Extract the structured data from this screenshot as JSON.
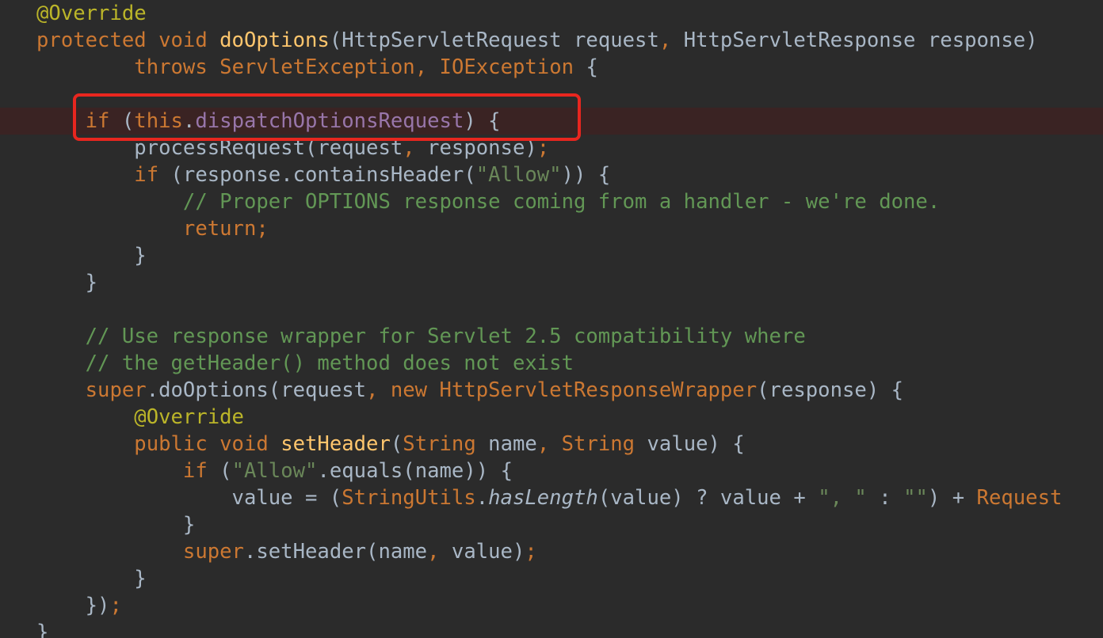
{
  "colors": {
    "background": "#2b2b2b",
    "breakpoint_line": "#3a2323",
    "keyword": "#cc7832",
    "annotation": "#bbb529",
    "method": "#ffc66d",
    "string": "#6a8759",
    "comment": "#629755",
    "field": "#9876aa",
    "plain": "#a9b7c6",
    "highlight_border": "#e8261f"
  },
  "code": {
    "lines": [
      [
        {
          "t": "ann",
          "v": "@Override"
        }
      ],
      [
        {
          "t": "kw",
          "v": "protected void "
        },
        {
          "t": "fn",
          "v": "doOptions"
        },
        {
          "t": "pl",
          "v": "(HttpServletRequest request"
        },
        {
          "t": "kw",
          "v": ", "
        },
        {
          "t": "pl",
          "v": "HttpServletResponse response)"
        }
      ],
      [
        {
          "t": "pl",
          "v": "        "
        },
        {
          "t": "kw",
          "v": "throws "
        },
        {
          "t": "kw",
          "v": "ServletException"
        },
        {
          "t": "kw",
          "v": ", "
        },
        {
          "t": "kw",
          "v": "IOException "
        },
        {
          "t": "pl",
          "v": "{"
        }
      ],
      [],
      [
        {
          "t": "pl",
          "v": "    "
        },
        {
          "t": "kw",
          "v": "if "
        },
        {
          "t": "pl",
          "v": "("
        },
        {
          "t": "kw",
          "v": "this"
        },
        {
          "t": "pl",
          "v": "."
        },
        {
          "t": "fld",
          "v": "dispatchOptionsRequest"
        },
        {
          "t": "pl",
          "v": ") {"
        }
      ],
      [
        {
          "t": "pl",
          "v": "        processRequest(request"
        },
        {
          "t": "kw",
          "v": ", "
        },
        {
          "t": "pl",
          "v": "response)"
        },
        {
          "t": "kw",
          "v": ";"
        }
      ],
      [
        {
          "t": "pl",
          "v": "        "
        },
        {
          "t": "kw",
          "v": "if "
        },
        {
          "t": "pl",
          "v": "(response.containsHeader("
        },
        {
          "t": "str",
          "v": "\"Allow\""
        },
        {
          "t": "pl",
          "v": ")) {"
        }
      ],
      [
        {
          "t": "pl",
          "v": "            "
        },
        {
          "t": "cmt",
          "v": "// Proper OPTIONS response coming from a handler - we're done."
        }
      ],
      [
        {
          "t": "pl",
          "v": "            "
        },
        {
          "t": "kw",
          "v": "return;"
        }
      ],
      [
        {
          "t": "pl",
          "v": "        }"
        }
      ],
      [
        {
          "t": "pl",
          "v": "    }"
        }
      ],
      [],
      [
        {
          "t": "pl",
          "v": "    "
        },
        {
          "t": "cmt",
          "v": "// Use response wrapper for Servlet 2.5 compatibility where"
        }
      ],
      [
        {
          "t": "pl",
          "v": "    "
        },
        {
          "t": "cmt",
          "v": "// the getHeader() method does not exist"
        }
      ],
      [
        {
          "t": "pl",
          "v": "    "
        },
        {
          "t": "kw",
          "v": "super"
        },
        {
          "t": "pl",
          "v": ".doOptions(request"
        },
        {
          "t": "kw",
          "v": ", new "
        },
        {
          "t": "kw",
          "v": "HttpServletResponseWrapper"
        },
        {
          "t": "pl",
          "v": "(response) {"
        }
      ],
      [
        {
          "t": "pl",
          "v": "        "
        },
        {
          "t": "ann",
          "v": "@Override"
        }
      ],
      [
        {
          "t": "pl",
          "v": "        "
        },
        {
          "t": "kw",
          "v": "public void "
        },
        {
          "t": "fn",
          "v": "setHeader"
        },
        {
          "t": "pl",
          "v": "("
        },
        {
          "t": "kw",
          "v": "String "
        },
        {
          "t": "pl",
          "v": "name"
        },
        {
          "t": "kw",
          "v": ", "
        },
        {
          "t": "kw",
          "v": "String "
        },
        {
          "t": "pl",
          "v": "value) {"
        }
      ],
      [
        {
          "t": "pl",
          "v": "            "
        },
        {
          "t": "kw",
          "v": "if "
        },
        {
          "t": "pl",
          "v": "("
        },
        {
          "t": "str",
          "v": "\"Allow\""
        },
        {
          "t": "pl",
          "v": ".equals(name)) {"
        }
      ],
      [
        {
          "t": "pl",
          "v": "                value = ("
        },
        {
          "t": "kw",
          "v": "StringUtils"
        },
        {
          "t": "pl",
          "v": "."
        },
        {
          "t": "it",
          "v": "hasLength"
        },
        {
          "t": "pl",
          "v": "(value) ? value + "
        },
        {
          "t": "str",
          "v": "\", \""
        },
        {
          "t": "pl",
          "v": " : "
        },
        {
          "t": "str",
          "v": "\"\""
        },
        {
          "t": "pl",
          "v": ") + "
        },
        {
          "t": "kw",
          "v": "Request"
        }
      ],
      [
        {
          "t": "pl",
          "v": "            }"
        }
      ],
      [
        {
          "t": "pl",
          "v": "            "
        },
        {
          "t": "kw",
          "v": "super"
        },
        {
          "t": "pl",
          "v": ".setHeader(name"
        },
        {
          "t": "kw",
          "v": ", "
        },
        {
          "t": "pl",
          "v": "value)"
        },
        {
          "t": "kw",
          "v": ";"
        }
      ],
      [
        {
          "t": "pl",
          "v": "        }"
        }
      ],
      [
        {
          "t": "pl",
          "v": "    })"
        },
        {
          "t": "kw",
          "v": ";"
        }
      ],
      [
        {
          "t": "pl",
          "v": "}"
        }
      ]
    ]
  }
}
